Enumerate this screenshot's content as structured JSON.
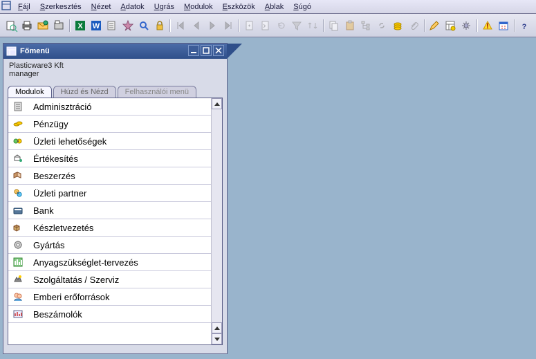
{
  "menu": {
    "items": [
      {
        "label": "Fájl",
        "ukey": "F"
      },
      {
        "label": "Szerkesztés",
        "ukey": "S"
      },
      {
        "label": "Nézet",
        "ukey": "N"
      },
      {
        "label": "Adatok",
        "ukey": "A"
      },
      {
        "label": "Ugrás",
        "ukey": "U"
      },
      {
        "label": "Modulok",
        "ukey": "M"
      },
      {
        "label": "Eszközök",
        "ukey": "E"
      },
      {
        "label": "Ablak",
        "ukey": "A"
      },
      {
        "label": "Súgó",
        "ukey": "S"
      }
    ]
  },
  "panel": {
    "title": "Főmenü",
    "company": "Plasticware3 Kft",
    "user": "manager",
    "tabs": [
      "Modulok",
      "Húzd és Nézd",
      "Felhasználói menü"
    ],
    "items": [
      "Adminisztráció",
      "Pénzügy",
      "Üzleti lehetőségek",
      "Értékesítés",
      "Beszerzés",
      "Üzleti partner",
      "Bank",
      "Készletvezetés",
      "Gyártás",
      "Anyagszükséglet-tervezés",
      "Szolgáltatás / Szerviz",
      "Emberi erőforrások",
      "Beszámolók"
    ]
  }
}
